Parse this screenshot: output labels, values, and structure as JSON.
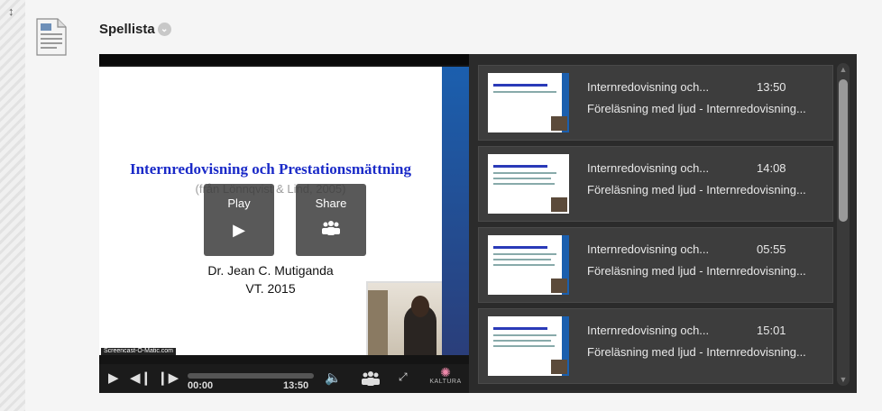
{
  "page": {
    "title": "Spellista"
  },
  "player": {
    "slide": {
      "title": "Internredovisning och Prestationsmättning",
      "subtitle": "(från Lönnqvist & Lind, 2005)",
      "author": "Dr. Jean C. Mutiganda",
      "term": "VT. 2015",
      "watermark": "Screencast-O-Matic.com"
    },
    "overlay": {
      "play_label": "Play",
      "share_label": "Share"
    },
    "controls": {
      "current_time": "00:00",
      "duration": "13:50",
      "brand": "KALTURA",
      "progress": 0.0
    }
  },
  "playlist": {
    "items": [
      {
        "name": "Internredovisning och...",
        "duration": "13:50",
        "description": "Föreläsning med ljud - Internredovisning..."
      },
      {
        "name": "Internredovisning och...",
        "duration": "14:08",
        "description": "Föreläsning med ljud - Internredovisning..."
      },
      {
        "name": "Internredovisning och...",
        "duration": "05:55",
        "description": "Föreläsning med ljud - Internredovisning..."
      },
      {
        "name": "Internredovisning och...",
        "duration": "15:01",
        "description": "Föreläsning med ljud - Internredovisning..."
      }
    ]
  },
  "icons": {
    "move": "move-handle-icon",
    "document": "document-icon",
    "play": "play-icon",
    "share": "share-icon",
    "prev": "previous-icon",
    "next": "next-icon",
    "volume": "volume-icon",
    "fullscreen": "fullscreen-icon"
  },
  "colors": {
    "slide_title": "#1a2ac8",
    "playlist_bg": "#2b2b2b",
    "item_bg": "#3d3d3d"
  }
}
